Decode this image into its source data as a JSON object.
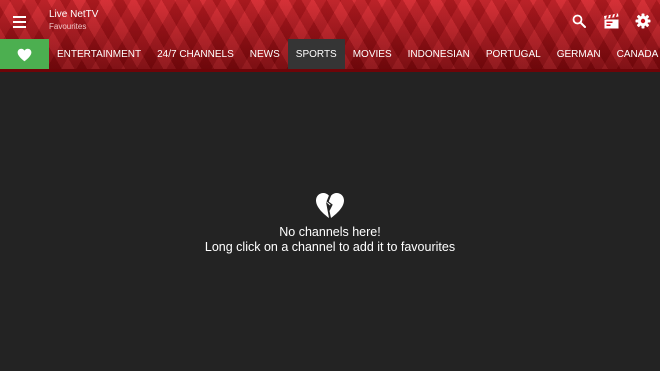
{
  "header": {
    "title": "Live NetTV",
    "subtitle": "Favourites",
    "menu_icon": "hamburger-menu-icon",
    "actions": {
      "search_icon": "search-icon",
      "video_icon": "clapperboard-icon",
      "settings_icon": "gear-icon"
    }
  },
  "tabs": {
    "favourites_icon": "heart-icon",
    "favourites_color": "#4caf50",
    "items": [
      {
        "label": "ENTERTAINMENT"
      },
      {
        "label": "24/7 CHANNELS"
      },
      {
        "label": "NEWS"
      },
      {
        "label": "SPORTS"
      },
      {
        "label": "MOVIES"
      },
      {
        "label": "INDONESIAN"
      },
      {
        "label": "PORTUGAL"
      },
      {
        "label": "GERMAN"
      },
      {
        "label": "CANADA"
      }
    ],
    "active_label": "SPORTS"
  },
  "empty_state": {
    "icon": "broken-heart-icon",
    "title": "No channels here!",
    "description": "Long click on a channel to add it to favourites"
  },
  "colors": {
    "header_red": "#c8101a",
    "background": "#232323",
    "active_tab": "#353535"
  }
}
